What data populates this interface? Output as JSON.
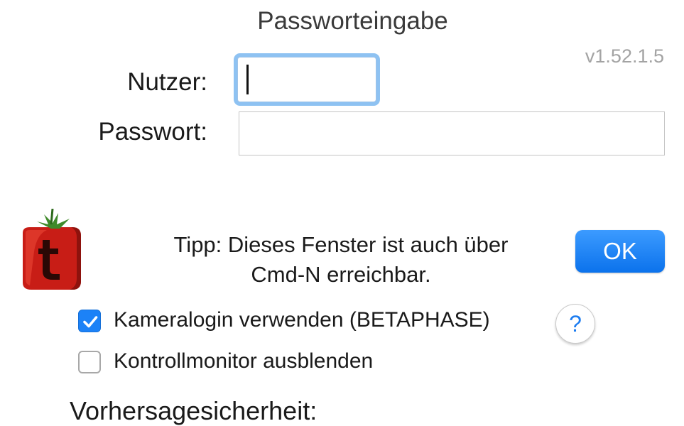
{
  "dialog": {
    "title": "Passworteingabe",
    "version": "v1.52.1.5"
  },
  "fields": {
    "user_label": "Nutzer:",
    "user_value": "",
    "password_label": "Passwort:",
    "password_value": ""
  },
  "tip": {
    "line1": "Tipp: Dieses Fenster ist auch über",
    "line2": "Cmd-N erreichbar."
  },
  "buttons": {
    "ok_label": "OK",
    "help_label": "?"
  },
  "options": [
    {
      "label": "Kameralogin verwenden (BETAPHASE)",
      "checked": true
    },
    {
      "label": "Kontrollmonitor ausblenden",
      "checked": false
    }
  ],
  "section": {
    "label": "Vorhersagesicherheit:"
  },
  "icons": {
    "logo": "tomato-t-logo-icon",
    "checkmark": "checkmark-icon"
  },
  "colors": {
    "accent": "#1c82f7",
    "focus_ring": "#8ec2f2",
    "logo_red": "#d9241c",
    "logo_leaf": "#3f8a2a",
    "version_text": "#a3a3a3"
  }
}
